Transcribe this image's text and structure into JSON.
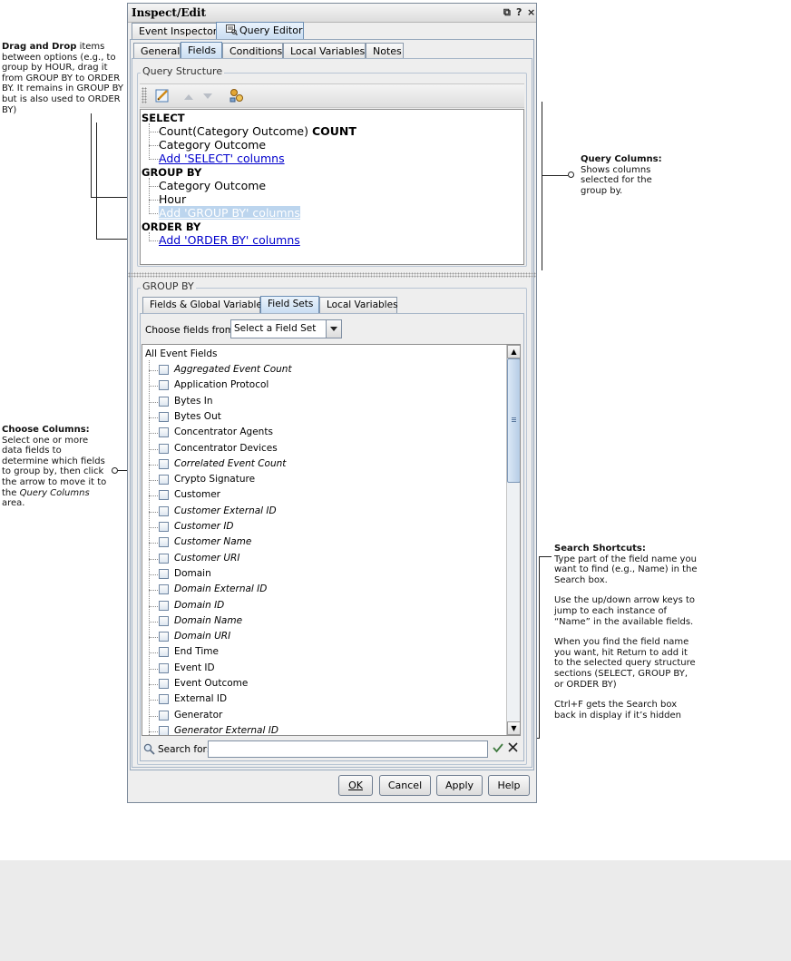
{
  "window": {
    "title": "Inspect/Edit",
    "title_buttons": [
      "⧉",
      "?",
      "×"
    ]
  },
  "top_tabs": [
    {
      "label": "Event Inspector",
      "active": false
    },
    {
      "label": "Query Editor",
      "active": true
    }
  ],
  "sub_tabs": [
    {
      "label": "General",
      "active": false
    },
    {
      "label": "Fields",
      "active": true
    },
    {
      "label": "Conditions",
      "active": false
    },
    {
      "label": "Local Variables",
      "active": false
    },
    {
      "label": "Notes",
      "active": false
    }
  ],
  "query_structure": {
    "label": "Query Structure",
    "toolbar_icons": [
      "edit-icon",
      "arrow-up-icon",
      "arrow-down-icon",
      "merge-icon"
    ],
    "select_header": "SELECT",
    "select_items": [
      {
        "text": "Count(Category Outcome)",
        "suffix": "COUNT"
      },
      {
        "text": "Category Outcome",
        "suffix": ""
      }
    ],
    "add_select": "Add 'SELECT' columns",
    "group_header": "GROUP BY",
    "group_items": [
      "Category Outcome",
      "Hour"
    ],
    "add_group": "Add 'GROUP BY' columns",
    "order_header": "ORDER BY",
    "add_order": "Add 'ORDER BY' columns"
  },
  "group_by": {
    "label": "GROUP BY",
    "tabs": [
      {
        "label": "Fields & Global Variables",
        "active": false
      },
      {
        "label": "Field Sets",
        "active": true
      },
      {
        "label": "Local Variables",
        "active": false
      }
    ],
    "choose_label": "Choose fields from:",
    "field_set_select": "Select a Field Set",
    "list_root": "All Event Fields",
    "fields": [
      {
        "label": "Aggregated Event Count",
        "italic": true
      },
      {
        "label": "Application Protocol",
        "italic": false
      },
      {
        "label": "Bytes In",
        "italic": false
      },
      {
        "label": "Bytes Out",
        "italic": false
      },
      {
        "label": "Concentrator Agents",
        "italic": false
      },
      {
        "label": "Concentrator Devices",
        "italic": false
      },
      {
        "label": "Correlated Event Count",
        "italic": true
      },
      {
        "label": "Crypto Signature",
        "italic": false
      },
      {
        "label": "Customer",
        "italic": false
      },
      {
        "label": "Customer External ID",
        "italic": true
      },
      {
        "label": "Customer ID",
        "italic": true
      },
      {
        "label": "Customer Name",
        "italic": true
      },
      {
        "label": "Customer URI",
        "italic": true
      },
      {
        "label": "Domain",
        "italic": false
      },
      {
        "label": "Domain External ID",
        "italic": true
      },
      {
        "label": "Domain ID",
        "italic": true
      },
      {
        "label": "Domain Name",
        "italic": true
      },
      {
        "label": "Domain URI",
        "italic": true
      },
      {
        "label": "End Time",
        "italic": false
      },
      {
        "label": "Event ID",
        "italic": false
      },
      {
        "label": "Event Outcome",
        "italic": false
      },
      {
        "label": "External ID",
        "italic": false
      },
      {
        "label": "Generator",
        "italic": false
      },
      {
        "label": "Generator External ID",
        "italic": true
      }
    ],
    "search_label": "Search for:",
    "search_value": ""
  },
  "buttons": {
    "ok": "OK",
    "cancel": "Cancel",
    "apply": "Apply",
    "help": "Help"
  },
  "callouts": {
    "drag_drop": {
      "title": "Drag and Drop",
      "text": " items between options (e.g., to group by HOUR, drag it from GROUP BY to ORDER BY. It remains in GROUP BY but is also used to ORDER BY)"
    },
    "query_columns": {
      "title": "Query Columns",
      "text": "Shows columns selected for the group by."
    },
    "choose_columns": {
      "title": "Choose Columns",
      "text_before": "Select one or more data fields to determine which fields to group by, then click the arrow to move it to the ",
      "text_italic": "Query Columns",
      "text_after": " area."
    },
    "search_shortcuts": {
      "title": "Search Shortcuts",
      "p1": "Type part of the field name you want to find (e.g., Name) in the Search box.",
      "p2": "Use the up/down arrow keys to jump to each instance of “Name” in the available fields.",
      "p3": "When you find the field name you want, hit Return to add it to the selected query structure sections (SELECT, GROUP BY, or ORDER BY)",
      "p4": "Ctrl+F gets the Search box back in display  if it’s hidden"
    }
  }
}
